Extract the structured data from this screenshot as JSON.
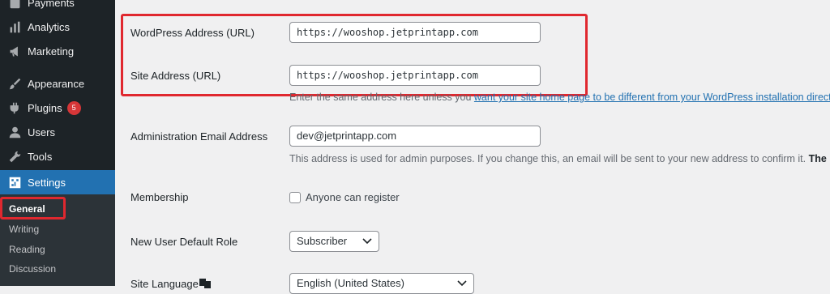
{
  "sidebar": {
    "items": [
      {
        "label": "Payments",
        "icon": "payments-icon"
      },
      {
        "label": "Analytics",
        "icon": "analytics-icon"
      },
      {
        "label": "Marketing",
        "icon": "megaphone-icon"
      },
      {
        "label": "Appearance",
        "icon": "paintbrush-icon"
      },
      {
        "label": "Plugins",
        "icon": "plugin-icon",
        "badge": "5"
      },
      {
        "label": "Users",
        "icon": "user-icon"
      },
      {
        "label": "Tools",
        "icon": "wrench-icon"
      },
      {
        "label": "Settings",
        "icon": "settings-icon"
      }
    ],
    "submenu": [
      "General",
      "Writing",
      "Reading",
      "Discussion"
    ]
  },
  "form": {
    "wp_address": {
      "label": "WordPress Address (URL)",
      "value": "https://wooshop.jetprintapp.com"
    },
    "site_address": {
      "label": "Site Address (URL)",
      "value": "https://wooshop.jetprintapp.com",
      "desc_prefix": "Enter the same address here unless you ",
      "desc_link": "want your site home page to be different from your WordPress installation directo"
    },
    "admin_email": {
      "label": "Administration Email Address",
      "value": "dev@jetprintapp.com",
      "desc": "This address is used for admin purposes. If you change this, an email will be sent to your new address to confirm it. ",
      "desc_bold": "The ne"
    },
    "membership": {
      "label": "Membership",
      "checkbox_label": "Anyone can register"
    },
    "default_role": {
      "label": "New User Default Role",
      "value": "Subscriber"
    },
    "site_language": {
      "label": "Site Language",
      "value": "English (United States)"
    }
  },
  "colors": {
    "accent": "#2271b1",
    "highlight": "#e0282f",
    "sidebar": "#1d2327"
  }
}
